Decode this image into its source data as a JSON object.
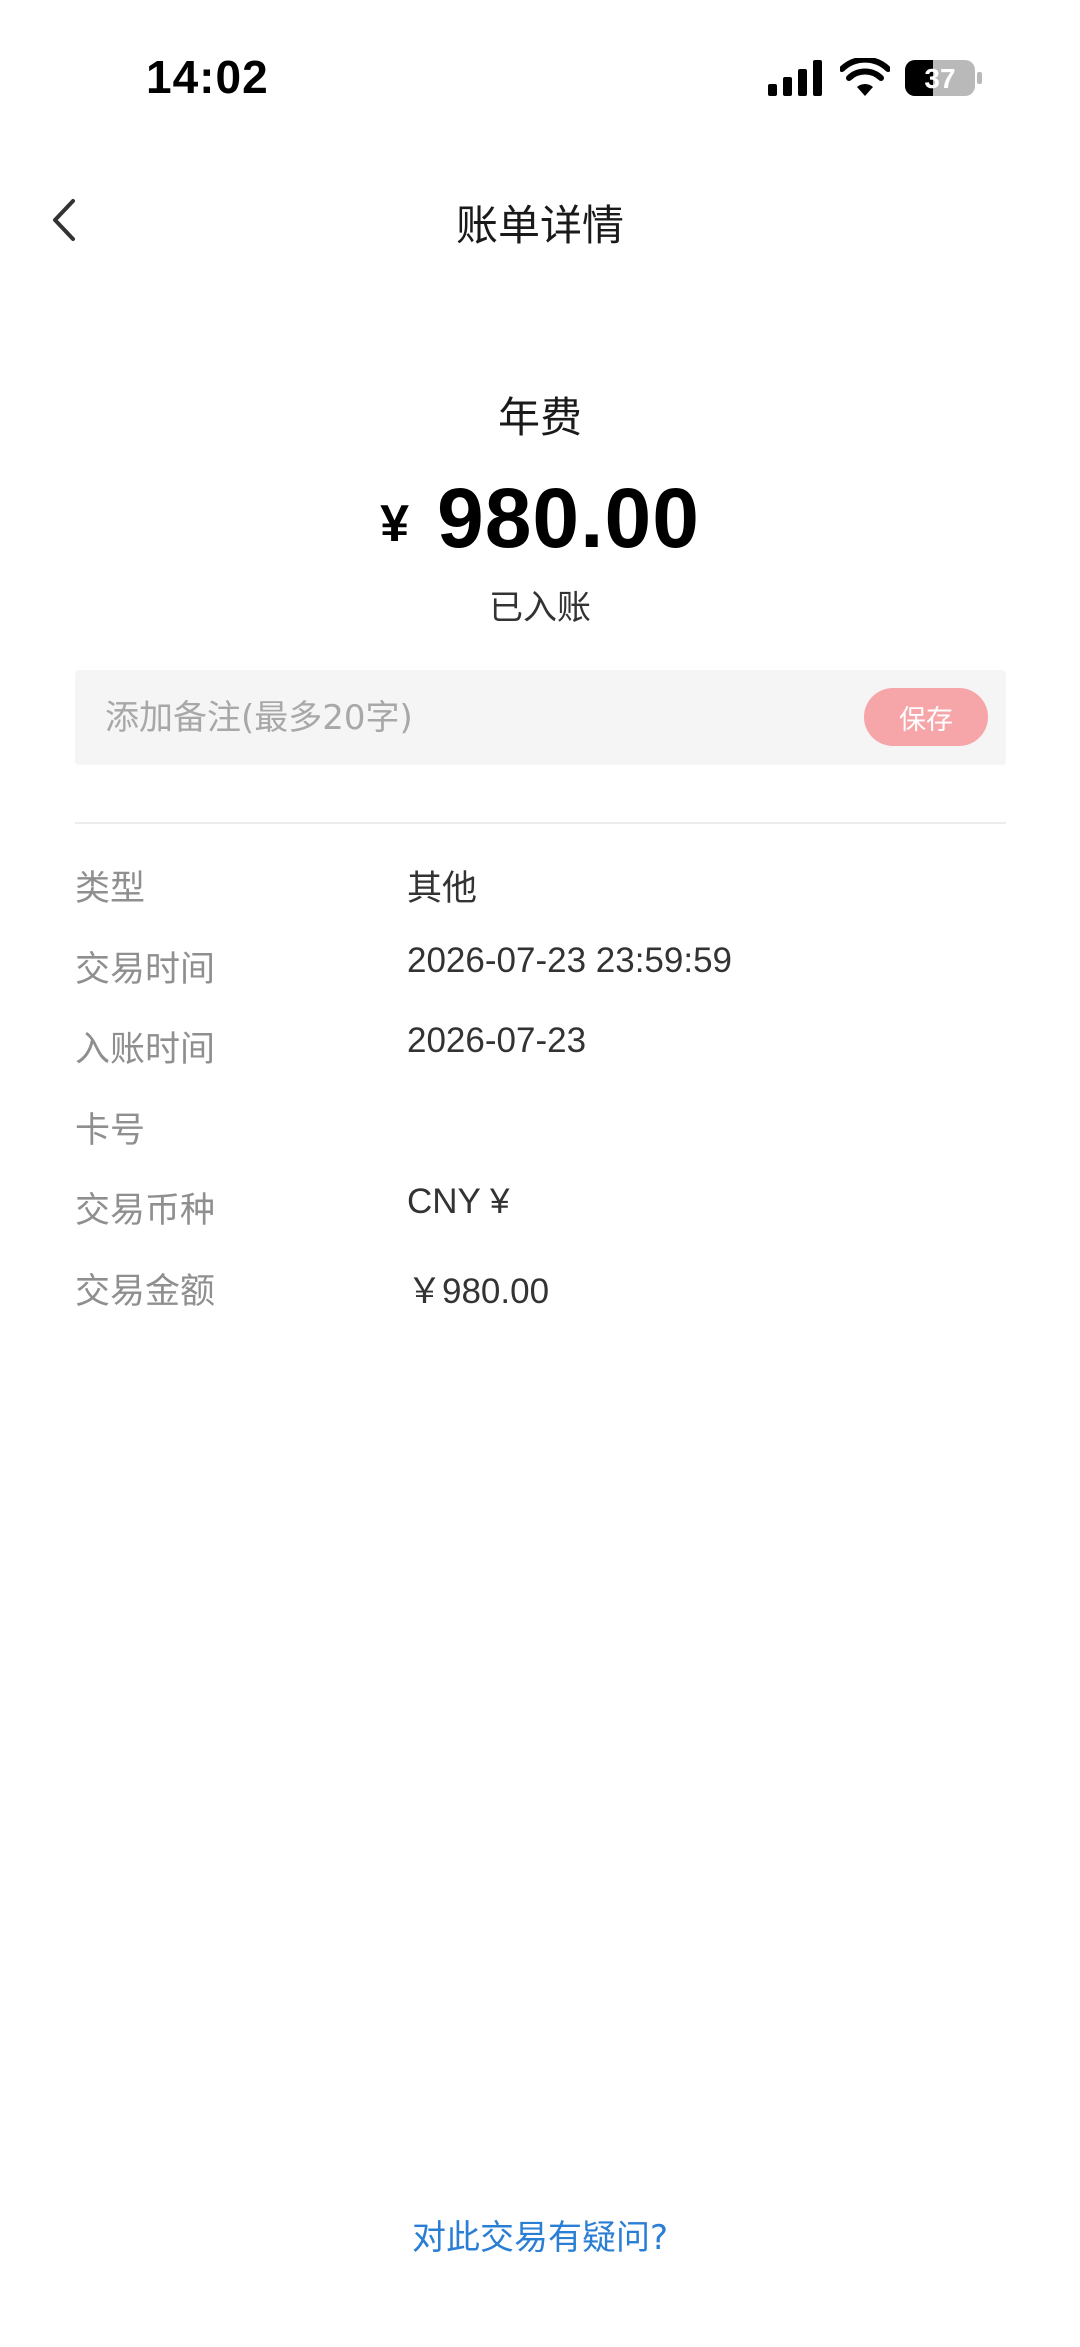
{
  "status_bar": {
    "time": "14:02",
    "battery_level": "37",
    "icons": [
      "signal-icon",
      "wifi-icon",
      "battery-icon"
    ]
  },
  "nav": {
    "title": "账单详情",
    "back_icon": "chevron-left-icon"
  },
  "summary": {
    "category": "年费",
    "currency_symbol": "¥",
    "amount": "980.00",
    "status": "已入账"
  },
  "remark": {
    "placeholder": "添加备注(最多20字)",
    "value": "",
    "save_label": "保存"
  },
  "details": [
    {
      "label": "类型",
      "value": "其他"
    },
    {
      "label": "交易时间",
      "value": "2026-07-23 23:59:59"
    },
    {
      "label": "入账时间",
      "value": "2026-07-23"
    },
    {
      "label": "卡号",
      "value": ""
    },
    {
      "label": "交易币种",
      "value": "CNY ¥"
    },
    {
      "label": "交易金额",
      "value": "￥980.00"
    }
  ],
  "footer": {
    "dispute_link": "对此交易有疑问?"
  },
  "colors": {
    "save_button_bg": "#f6a5a8",
    "link": "#2a7fd4",
    "label_gray": "#8f8f8f",
    "remark_bg": "#f5f5f5"
  }
}
